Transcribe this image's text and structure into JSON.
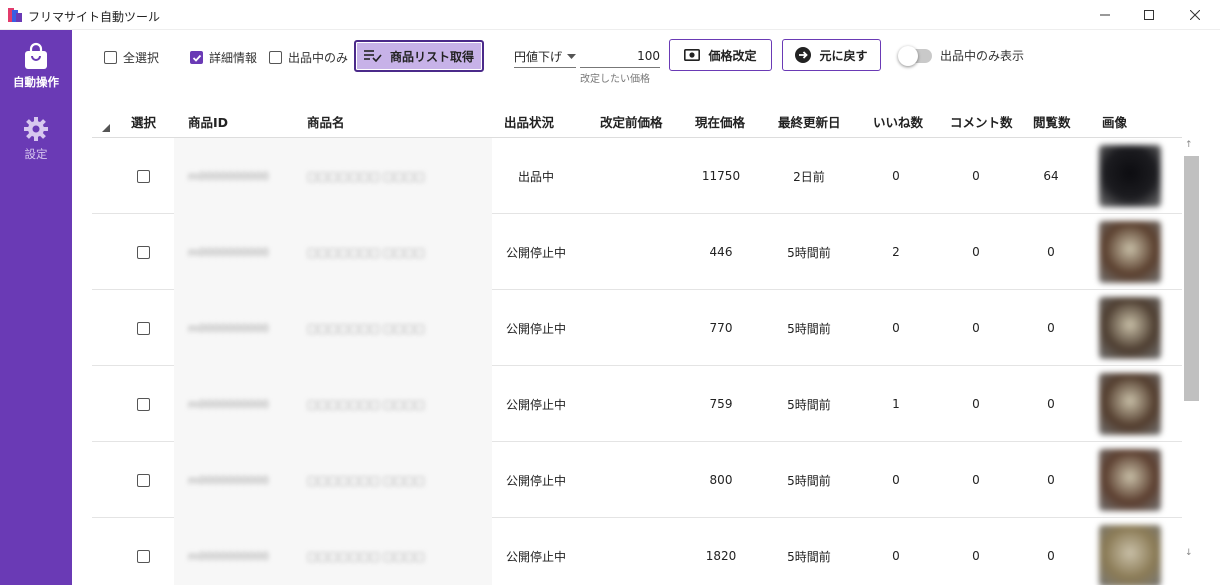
{
  "window": {
    "title": "フリマサイト自動ツール"
  },
  "sidebar": {
    "items": [
      {
        "label": "自動操作",
        "icon": "shopping-bag-icon",
        "active": true
      },
      {
        "label": "設定",
        "icon": "gear-icon",
        "active": false
      }
    ]
  },
  "toolbar": {
    "select_all_label": "全選択",
    "select_all_checked": false,
    "details_label": "詳細情報",
    "details_checked": true,
    "listed_only_label": "出品中のみ",
    "listed_only_checked": false,
    "get_list_label": "商品リスト取得",
    "mode_select_value": "円値下げ",
    "price_value": "100",
    "price_hint": "改定したい価格",
    "revise_price_label": "価格改定",
    "revert_label": "元に戻す",
    "show_listed_toggle_label": "出品中のみ表示",
    "show_listed_toggle_on": false
  },
  "table": {
    "columns": [
      "選択",
      "商品ID",
      "商品名",
      "出品状況",
      "改定前価格",
      "現在価格",
      "最終更新日",
      "いいね数",
      "コメント数",
      "閲覧数",
      "画像"
    ],
    "rows": [
      {
        "status": "出品中",
        "before_price": "",
        "current_price": "11750",
        "updated": "2日前",
        "likes": "0",
        "comments": "0",
        "views": "64",
        "thumb_color": "#1c1c20"
      },
      {
        "status": "公開停止中",
        "before_price": "",
        "current_price": "446",
        "updated": "5時間前",
        "likes": "2",
        "comments": "0",
        "views": "0",
        "thumb_color": "#5a3f2e"
      },
      {
        "status": "公開停止中",
        "before_price": "",
        "current_price": "770",
        "updated": "5時間前",
        "likes": "0",
        "comments": "0",
        "views": "0",
        "thumb_color": "#4d3d30"
      },
      {
        "status": "公開停止中",
        "before_price": "",
        "current_price": "759",
        "updated": "5時間前",
        "likes": "1",
        "comments": "0",
        "views": "0",
        "thumb_color": "#523c2d"
      },
      {
        "status": "公開停止中",
        "before_price": "",
        "current_price": "800",
        "updated": "5時間前",
        "likes": "0",
        "comments": "0",
        "views": "0",
        "thumb_color": "#5b3e2f"
      },
      {
        "status": "公開停止中",
        "before_price": "",
        "current_price": "1820",
        "updated": "5時間前",
        "likes": "0",
        "comments": "0",
        "views": "0",
        "thumb_color": "#8a7a55"
      }
    ]
  },
  "colors": {
    "accent": "#6a3ab5",
    "accent_light": "#c7b2e8"
  }
}
